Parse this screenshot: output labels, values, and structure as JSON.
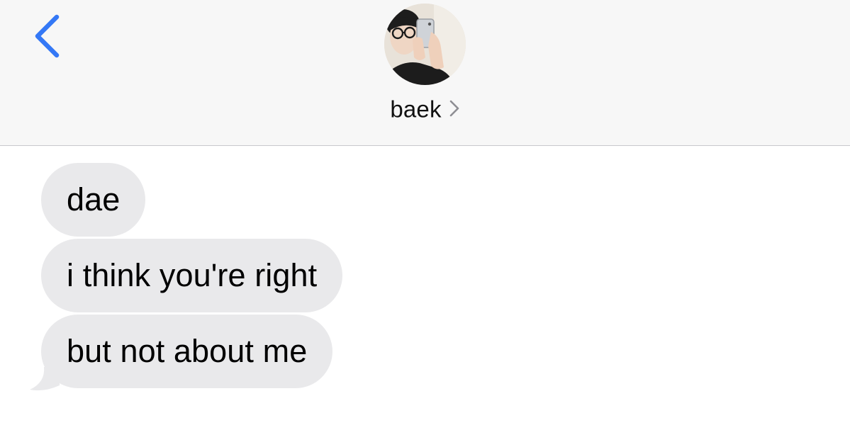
{
  "header": {
    "back_icon": "chevron-left-icon",
    "contact_name": "baek",
    "name_chevron_icon": "chevron-right-icon",
    "accent_color": "#3478f6"
  },
  "messages": [
    {
      "text": "dae",
      "direction": "incoming"
    },
    {
      "text": "i think you're right",
      "direction": "incoming"
    },
    {
      "text": "but not about me",
      "direction": "incoming"
    }
  ],
  "colors": {
    "header_bg": "#f7f7f7",
    "incoming_bubble": "#e9e9eb",
    "text": "#000000"
  }
}
